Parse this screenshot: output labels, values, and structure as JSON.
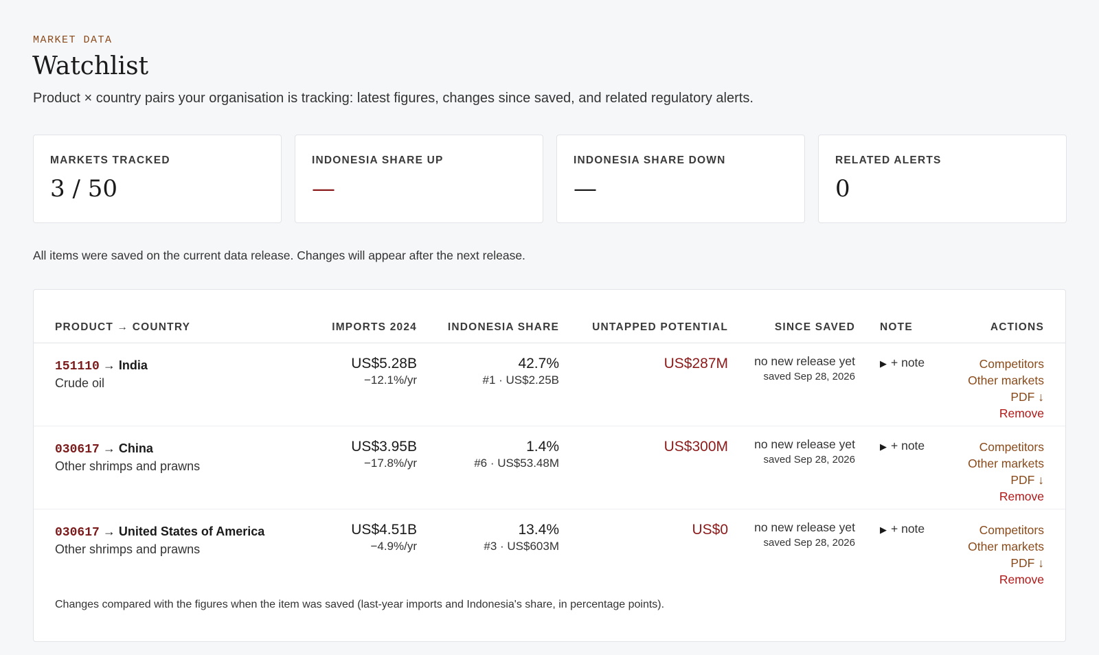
{
  "header": {
    "eyebrow": "MARKET DATA",
    "title": "Watchlist",
    "subtitle": "Product × country pairs your organisation is tracking: latest figures, changes since saved, and related regulatory alerts."
  },
  "cards": [
    {
      "label": "MARKETS TRACKED",
      "value": "3 / 50"
    },
    {
      "label": "INDONESIA SHARE UP",
      "value": "—"
    },
    {
      "label": "INDONESIA SHARE DOWN",
      "value": "—"
    },
    {
      "label": "RELATED ALERTS",
      "value": "0"
    }
  ],
  "release_note": "All items were saved on the current data release. Changes will appear after the next release.",
  "table": {
    "columns": {
      "product_country": "PRODUCT → COUNTRY",
      "imports": "IMPORTS 2024",
      "share": "INDONESIA SHARE",
      "potential": "UNTAPPED POTENTIAL",
      "since": "SINCE SAVED",
      "note": "NOTE",
      "actions": "ACTIONS"
    },
    "rows": [
      {
        "code": "151110",
        "arrow": "→",
        "country": "India",
        "product": "Crude oil",
        "imports": "US$5.28B",
        "imports_change": "−12.1%/yr",
        "share": "42.7%",
        "share_detail": "#1 · US$2.25B",
        "potential": "US$287M",
        "since": "no new release yet",
        "saved": "saved Sep 28, 2026",
        "note": "+ note",
        "actions": {
          "competitors": "Competitors",
          "other": "Other markets",
          "pdf": "PDF ↓",
          "remove": "Remove"
        }
      },
      {
        "code": "030617",
        "arrow": "→",
        "country": "China",
        "product": "Other shrimps and prawns",
        "imports": "US$3.95B",
        "imports_change": "−17.8%/yr",
        "share": "1.4%",
        "share_detail": "#6 · US$53.48M",
        "potential": "US$300M",
        "since": "no new release yet",
        "saved": "saved Sep 28, 2026",
        "note": "+ note",
        "actions": {
          "competitors": "Competitors",
          "other": "Other markets",
          "pdf": "PDF ↓",
          "remove": "Remove"
        }
      },
      {
        "code": "030617",
        "arrow": "→",
        "country": "United States of America",
        "product": "Other shrimps and prawns",
        "imports": "US$4.51B",
        "imports_change": "−4.9%/yr",
        "share": "13.4%",
        "share_detail": "#3 · US$603M",
        "potential": "US$0",
        "since": "no new release yet",
        "saved": "saved Sep 28, 2026",
        "note": "+ note",
        "actions": {
          "competitors": "Competitors",
          "other": "Other markets",
          "pdf": "PDF ↓",
          "remove": "Remove"
        }
      }
    ],
    "footnote": "Changes compared with the figures when the item was saved (last-year imports and Indonesia's share, in percentage points)."
  },
  "colors": {
    "accent": "#8b1a1a",
    "link": "#8a4a1a",
    "remove": "#b01818",
    "background": "#f6f7f9"
  }
}
